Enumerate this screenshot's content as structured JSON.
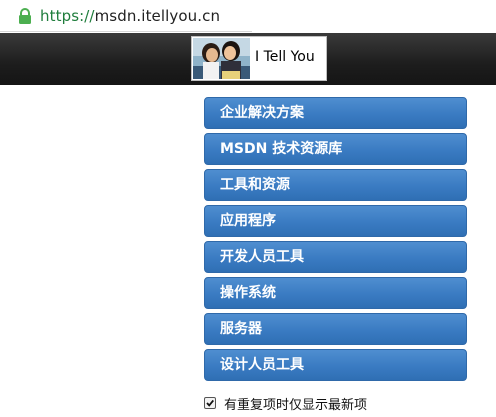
{
  "address_bar": {
    "scheme": "https://",
    "host": "msdn.itellyou.cn",
    "lock_icon": "lock-icon",
    "lock_color": "#4caf50"
  },
  "header": {
    "logo_text": "I Tell You",
    "background": "#1d1d1d"
  },
  "menu": {
    "items": [
      {
        "label": "企业解决方案"
      },
      {
        "label": "MSDN 技术资源库"
      },
      {
        "label": "工具和资源"
      },
      {
        "label": "应用程序"
      },
      {
        "label": "开发人员工具"
      },
      {
        "label": "操作系统"
      },
      {
        "label": "服务器"
      },
      {
        "label": "设计人员工具"
      }
    ],
    "accent": "#3a7bc2"
  },
  "filter": {
    "checked": true,
    "label": "有重复项时仅显示最新项"
  }
}
